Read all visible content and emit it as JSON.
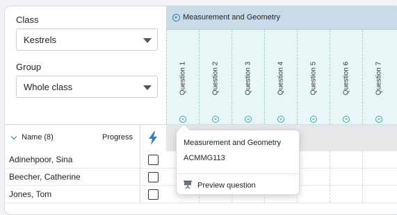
{
  "class_filter": {
    "label": "Class",
    "value": "Kestrels"
  },
  "group_filter": {
    "label": "Group",
    "value": "Whole class"
  },
  "strand_header": {
    "title": "Measurement and Geometry",
    "icon": "chevron-circle-icon"
  },
  "questions": [
    "Question 1",
    "Question 2",
    "Question 3",
    "Question 4",
    "Question 5",
    "Question 6",
    "Question 7"
  ],
  "names_header": {
    "name_label": "Name (8)",
    "progress_label": "Progress",
    "bolt_icon": "lightning-icon"
  },
  "students": [
    "Adinehpoor, Sina",
    "Beecher, Catherine",
    "Jones, Tom"
  ],
  "popup": {
    "strand": "Measurement and Geometry",
    "code": "ACMMG113",
    "preview_label": "Preview question",
    "preview_icon": "presentation-icon"
  },
  "colors": {
    "accent_blue": "#2a6fb0",
    "teal": "#3aa7b0",
    "header_bg": "#c9dbe8",
    "question_bg": "#e9f6f7",
    "bolt": "#2e7fc9"
  }
}
